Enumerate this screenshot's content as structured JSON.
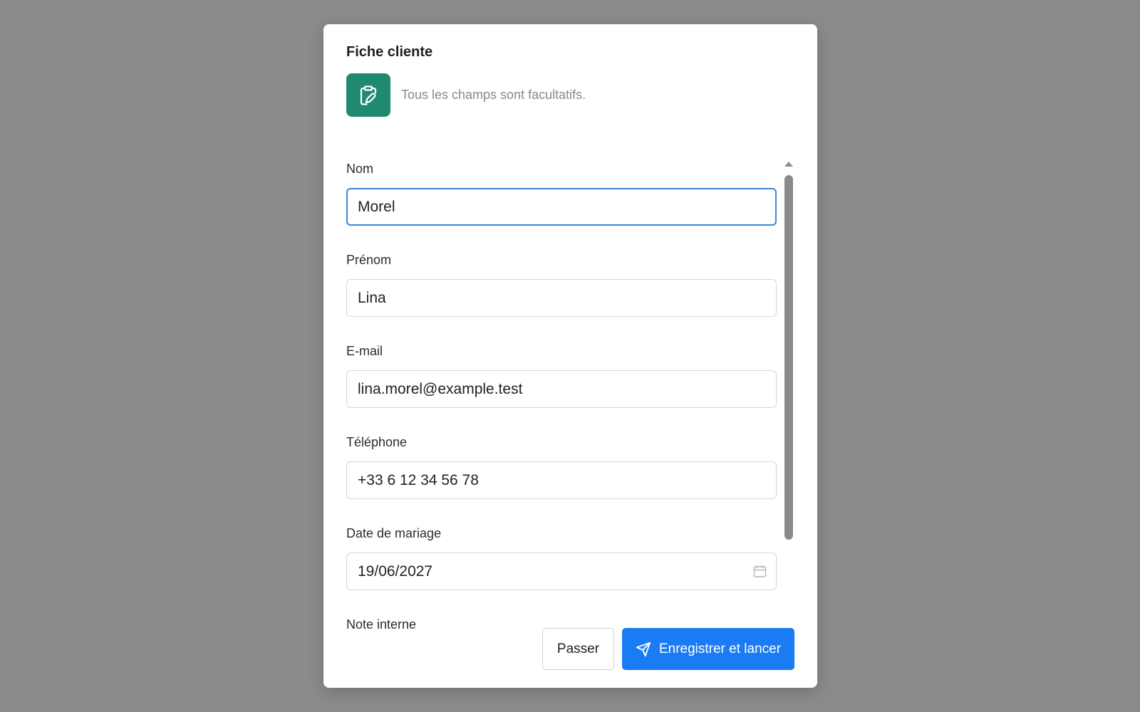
{
  "dialog": {
    "title": "Fiche cliente",
    "subtitle": "Tous les champs sont facultatifs.",
    "header_icon": "clipboard-edit-icon",
    "header_icon_bg": "#1f8a6e"
  },
  "form": {
    "nom": {
      "label": "Nom",
      "value": "Morel"
    },
    "prenom": {
      "label": "Prénom",
      "value": "Lina"
    },
    "email": {
      "label": "E-mail",
      "value": "lina.morel@example.test"
    },
    "telephone": {
      "label": "Téléphone",
      "value": "+33 6 12 34 56 78"
    },
    "date_mariage": {
      "label": "Date de mariage",
      "value": "19/06/2027",
      "icon": "calendar-icon"
    },
    "note_interne": {
      "label": "Note interne"
    }
  },
  "actions": {
    "skip_label": "Passer",
    "submit_label": "Enregistrer et lancer",
    "submit_icon": "send-icon",
    "accent": "#1a7cf5"
  }
}
